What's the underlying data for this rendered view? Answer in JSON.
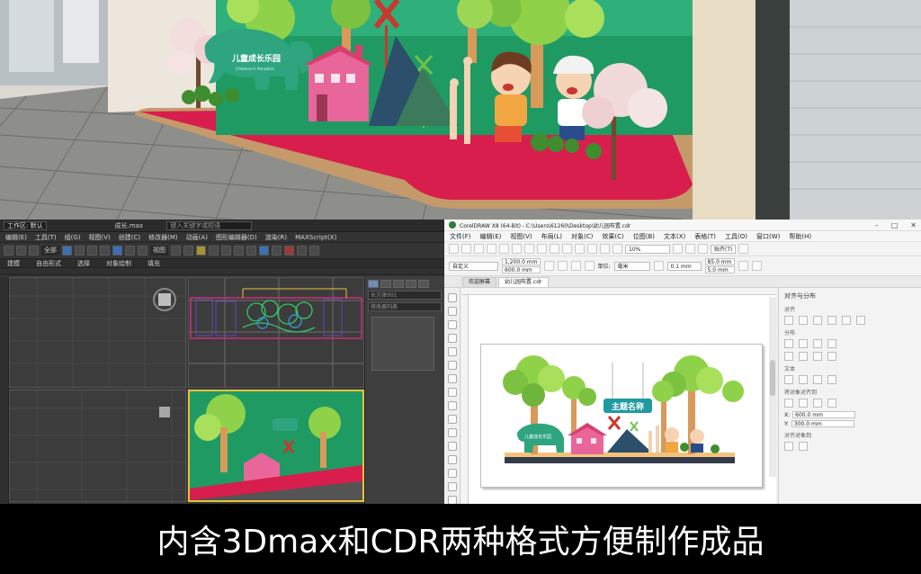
{
  "render": {
    "sign_title": "儿童成长乐园",
    "sign_subtitle": "Children's Paradise"
  },
  "max": {
    "workspace": "工作区: 默认",
    "file_name": "成长.max",
    "search_placeholder": "键入关键字或短语",
    "menus": [
      "编辑(E)",
      "工具(T)",
      "组(G)",
      "视图(V)",
      "创建(C)",
      "修改器(M)",
      "动画(A)",
      "图形编辑器(D)",
      "渲染(R)",
      "Civil View",
      "自定义(U)",
      "MAXScript(X)",
      "帮助(H)"
    ],
    "ribbon": [
      "建模",
      "自由形式",
      "选择",
      "对象绘制",
      "填充"
    ],
    "view_select": "全部",
    "view_mode": "视图",
    "command_fields": [
      "长方体001",
      "修改器列表"
    ]
  },
  "cdr": {
    "title": "CorelDRAW X8 (64-Bit) - C:\\Users\\61260\\Desktop\\幼儿园布置.cdr",
    "menus": [
      "文件(F)",
      "编辑(E)",
      "视图(V)",
      "布局(L)",
      "对象(C)",
      "效果(C)",
      "位图(B)",
      "文本(X)",
      "表格(T)",
      "工具(O)",
      "窗口(W)",
      "帮助(H)"
    ],
    "zoom": "10%",
    "snap": "贴齐(T)",
    "preset": "自定义",
    "width": "1,200.0 mm",
    "height": "600.0 mm",
    "units_label": "单位:",
    "units": "毫米",
    "nudge": "0.1 mm",
    "dup_x": "85.0 mm",
    "dup_y": "5.0 mm",
    "tabs": [
      "欢迎屏幕",
      "幼儿园布置.cdr"
    ],
    "docker_title": "对齐与分布",
    "docker_groups": [
      "对齐",
      "分布",
      "文本",
      "将对象对齐到",
      "对齐对象到"
    ],
    "docker_x": "600.0 mm",
    "docker_y": "300.0 mm",
    "artwork_sign": "主题名称",
    "artwork_small": "儿童成长乐园"
  },
  "caption": "内含3Dmax和CDR两种格式方便制作成品"
}
